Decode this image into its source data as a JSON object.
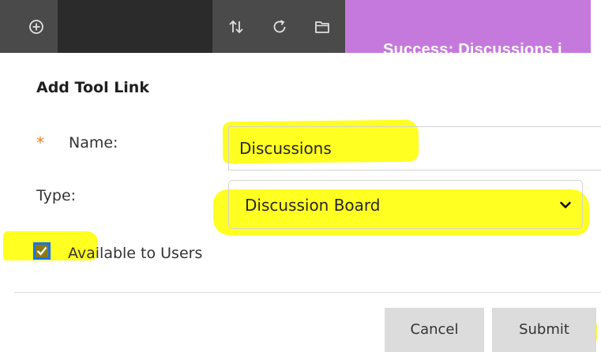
{
  "toolbar": {
    "icons": [
      "add-circle-icon",
      "reorder-arrows-icon",
      "refresh-icon",
      "folder-icon"
    ],
    "background": "#4a4a4a"
  },
  "banner": {
    "text": "Success: Discussions i",
    "background": "#c679dc"
  },
  "form": {
    "title": "Add Tool Link",
    "required_marker": "*",
    "name_label": "Name:",
    "name_value": "Discussions",
    "type_label": "Type:",
    "type_value": "Discussion Board",
    "available_label": "Available to Users",
    "available_checked": true
  },
  "actions": {
    "cancel_label": "Cancel",
    "submit_label": "Submit"
  },
  "colors": {
    "highlight": "#ffff21",
    "required": "#e8832d",
    "checkbox_focus": "#1a73e8",
    "button_bg": "#dcdcdc"
  }
}
